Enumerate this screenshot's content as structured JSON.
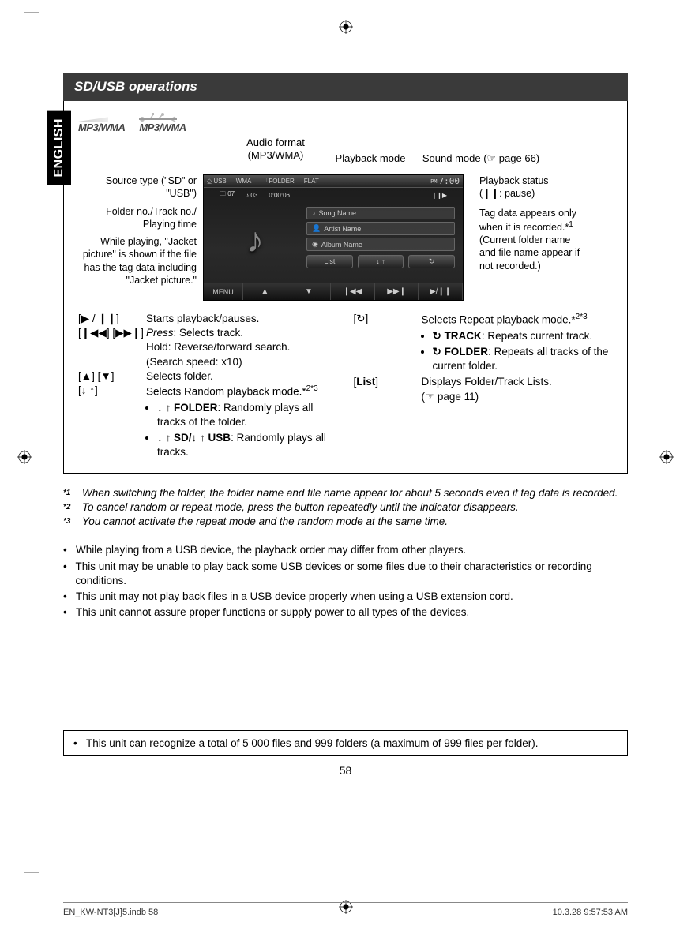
{
  "page": {
    "number": "58",
    "language": "ENGLISH",
    "section_title": "SD/USB operations"
  },
  "format_labels": {
    "sd": "MP3/WMA",
    "usb": "MP3/WMA"
  },
  "top_callouts": {
    "audio_format_l1": "Audio format",
    "audio_format_l2": "(MP3/WMA)",
    "playback_mode": "Playback mode",
    "sound_mode": "Sound mode (☞ page 66)"
  },
  "left_callouts": {
    "source": "Source type (\"SD\" or \"USB\")",
    "folder_l1": "Folder no./Track no./",
    "folder_l2": "Playing time",
    "jacket_l1": "While playing, \"Jacket",
    "jacket_l2": "picture\" is shown if the file",
    "jacket_l3": "has the tag data including",
    "jacket_l4": "\"Jacket picture.\""
  },
  "right_callouts": {
    "status_l1": "Playback status",
    "status_l2": "(❙❙: pause)",
    "tag_l1": "Tag data appears only",
    "tag_l2": "when it is recorded.*",
    "tag_sup": "1",
    "tag_l3": "(Current folder name",
    "tag_l4": "and file name appear if",
    "tag_l5": "not recorded.)"
  },
  "screen": {
    "top": {
      "src_icon": "USB",
      "fmt": "WMA",
      "folder": "FOLDER",
      "eq": "FLAT",
      "clock_pm": "PM",
      "clock": "7:00"
    },
    "info": {
      "folder_no": "07",
      "track_no": "03",
      "time": "0:00:06",
      "status": "❙❙▶"
    },
    "meta": {
      "song": "Song Name",
      "artist": "Artist Name",
      "album": "Album Name"
    },
    "meta_btns": {
      "list": "List",
      "random": "↓ ↑",
      "repeat": "↻"
    },
    "bottom": {
      "menu": "MENU",
      "up": "▲",
      "down": "▼",
      "prev": "❙◀◀",
      "next": "▶▶❙",
      "play": "▶/❙❙"
    },
    "album_placeholder": "♪"
  },
  "controls_left": [
    {
      "key": "[▶ / ❙❙]",
      "desc": "Starts playback/pauses."
    },
    {
      "key": "[❙◀◀] [▶▶❙]",
      "desc_html": "press_hold"
    },
    {
      "key": "[▲] [▼]",
      "desc": "Selects folder."
    },
    {
      "key": "[↓ ↑]",
      "desc_html": "random"
    }
  ],
  "control_strings": {
    "press_label": "Press",
    "press_text": ": Selects track.",
    "hold_text": "Hold: Reverse/forward search.",
    "search_speed": "(Search speed: x10)",
    "random_intro": "Selects Random playback mode.*",
    "random_sup": "2",
    "random_sup2": "3",
    "random_folder_icon": "↓ ↑",
    "random_folder_b": " FOLDER",
    "random_folder_t": ": Randomly plays all tracks of the folder.",
    "random_sd_icon": "↓ ↑",
    "random_sd_b": " SD/",
    "random_usb_icon": "↓ ↑",
    "random_usb_b": " USB",
    "random_sd_t": ": Randomly plays all tracks."
  },
  "controls_right": [
    {
      "key": "[↻]",
      "desc_html": "repeat"
    },
    {
      "key": "[List]",
      "desc_html": "list"
    }
  ],
  "control_strings_r": {
    "repeat_intro": "Selects Repeat playback mode.*",
    "repeat_sup": "2",
    "repeat_sup2": "3",
    "repeat_track_icon": "↻",
    "repeat_track_b": " TRACK",
    "repeat_track_t": ": Repeats current track.",
    "repeat_folder_icon": "↻",
    "repeat_folder_b": " FOLDER",
    "repeat_folder_t": ": Repeats all tracks of the current folder.",
    "list_text": "Displays Folder/Track Lists.",
    "list_page": "(☞ page 11)",
    "list_key_bold": "List"
  },
  "footnotes": {
    "f1_sup": "*1",
    "f1": "When switching the folder, the folder name and file name appear for about 5 seconds even if tag data is recorded.",
    "f2_sup": "*2",
    "f2": "To cancel random or repeat mode, press the button repeatedly until the indicator disappears.",
    "f3_sup": "*3",
    "f3": "You cannot activate the repeat mode and the random mode at the same time."
  },
  "bullets": {
    "b1": "While playing from a USB device, the playback order may differ from other players.",
    "b2": "This unit may be unable to play back some USB devices or some files due to their characteristics or recording conditions.",
    "b3": "This unit may not play back files in a USB device properly when using a USB extension cord.",
    "b4": "This unit cannot assure proper functions or supply power to all types of the devices."
  },
  "note_box": "This unit can recognize a total of 5 000 files and 999 folders (a maximum of 999 files per folder).",
  "footer": {
    "left": "EN_KW-NT3[J]5.indb   58",
    "right": "10.3.28   9:57:53 AM"
  }
}
